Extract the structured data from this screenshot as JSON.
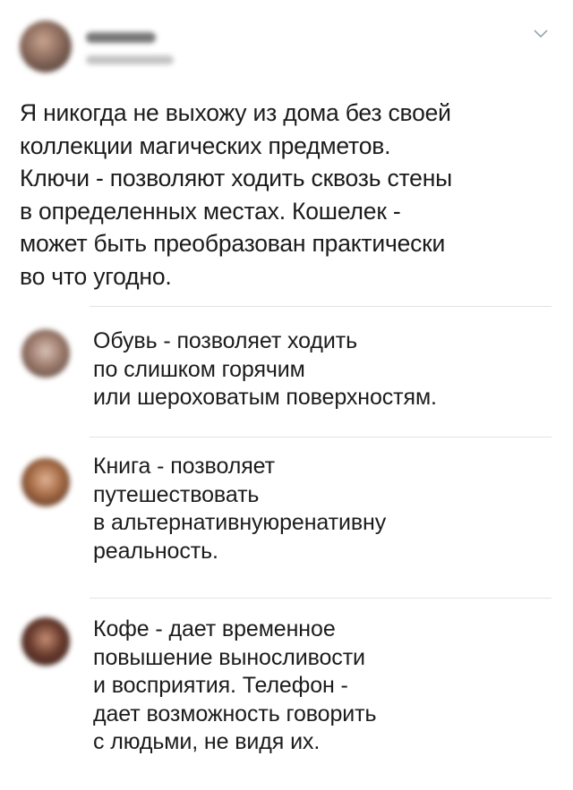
{
  "post": {
    "text": "Я никогда не выхожу из дома без своей\nколлекции магических предметов.\nКлючи - позволяют ходить сквозь стены\nв определенных местах. Кошелек -\nможет быть преобразован практически\nво что угодно.",
    "menu_icon": "chevron-down-icon"
  },
  "replies": [
    {
      "text": "Обувь - позволяет ходить\nпо слишком горячим\nили шероховатым поверхностям."
    },
    {
      "text": "Книга - позволяет\nпутешествовать\nв альтернативнуюренативну\nреальность."
    },
    {
      "text": "Кофе - дает временное\nповышение выносливости\nи восприятия. Телефон -\nдает возможность говорить\nс людьми, не видя их."
    }
  ]
}
